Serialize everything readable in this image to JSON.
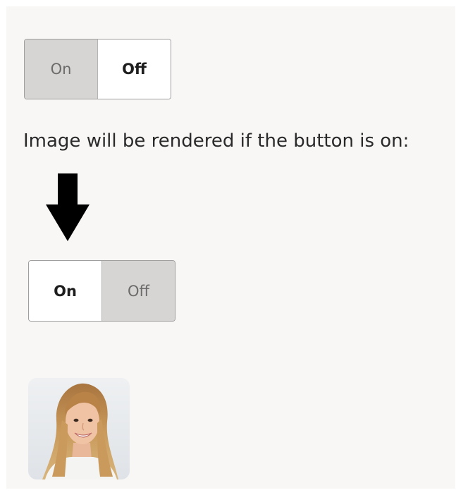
{
  "toggle_top": {
    "on_label": "On",
    "off_label": "Off",
    "selected": "On"
  },
  "caption": "Image will be rendered if the button is on:",
  "arrow_icon": "arrow-down-icon",
  "toggle_bottom": {
    "on_label": "On",
    "off_label": "Off",
    "selected": "Off"
  },
  "avatar_icon": "portrait-photo",
  "colors": {
    "panel_bg": "#f8f7f6",
    "active_segment": "#d7d5d3",
    "border": "#9e9e9e",
    "text": "#2a2a2a"
  }
}
